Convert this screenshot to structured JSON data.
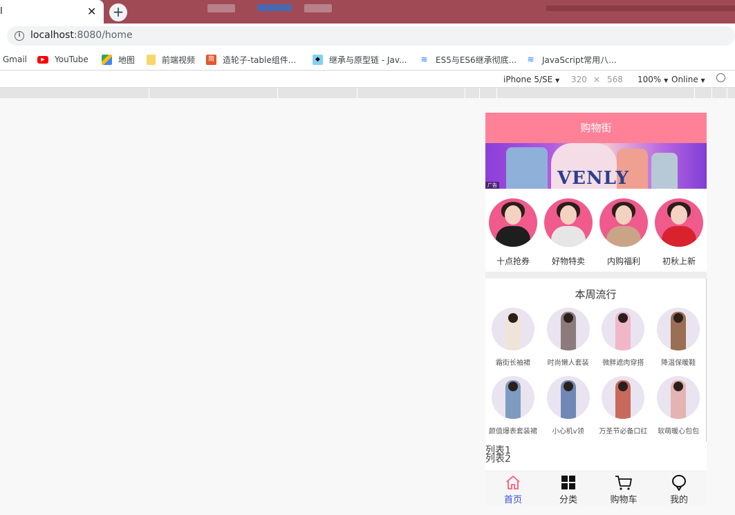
{
  "browser": {
    "tab_title": "I",
    "tab_close": "✕",
    "new_tab": "+",
    "url_host": "localhost",
    "url_rest": ":8080/home"
  },
  "bookmarks": [
    {
      "label": "Gmail",
      "icon": "gmail-icon"
    },
    {
      "label": "YouTube",
      "icon": "youtube-icon",
      "color": "#ff0000"
    },
    {
      "label": "地图",
      "icon": "maps-icon",
      "color": "#34a853"
    },
    {
      "label": "前端视频",
      "icon": "folder-icon",
      "color": "#f9d66b"
    },
    {
      "label": "造轮子-table组件...",
      "icon": "jian-icon",
      "color": "#e4572e"
    },
    {
      "label": "继承与原型链 - Jav...",
      "icon": "mdn-icon",
      "color": "#83d0f2"
    },
    {
      "label": "ES5与ES6继承彻底...",
      "icon": "juejin-icon",
      "color": "#1e80ff"
    },
    {
      "label": "JavaScript常用八...",
      "icon": "juejin-icon",
      "color": "#1e80ff"
    }
  ],
  "device_toolbar": {
    "device": "iPhone 5/SE",
    "width": "320",
    "times": "×",
    "height": "568",
    "zoom": "100%",
    "network": "Online",
    "caret": "▼"
  },
  "app": {
    "title": "购物街",
    "banner_brand": "VENLY",
    "banner_ad": "广告",
    "recommends": [
      {
        "label": "十点抢券",
        "color": "#1e1e1e"
      },
      {
        "label": "好物特卖",
        "color": "#e6e6e6"
      },
      {
        "label": "内购福利",
        "color": "#c9a487"
      },
      {
        "label": "初秋上新",
        "color": "#d8232f"
      }
    ],
    "feature_title": "本周流行",
    "features": [
      {
        "label": "霜街长袖裙",
        "color": "#efe4d8"
      },
      {
        "label": "时尚懒人套装",
        "color": "#8d7a7c"
      },
      {
        "label": "微胖遮肉穿搭",
        "color": "#f0b7c8"
      },
      {
        "label": "降温保暖鞋",
        "color": "#9b6f53"
      },
      {
        "label": "颜值爆表套装裙",
        "color": "#7f9bbf"
      },
      {
        "label": "小心机v领",
        "color": "#6f88b5"
      },
      {
        "label": "万圣节必备口红",
        "color": "#c76a5c"
      },
      {
        "label": "软萌暖心包包",
        "color": "#e3b4b1"
      }
    ],
    "list_items": [
      "列表1",
      "列表2"
    ],
    "tabs": [
      {
        "label": "首页",
        "icon": "home-icon",
        "active": true
      },
      {
        "label": "分类",
        "icon": "category-icon",
        "active": false
      },
      {
        "label": "购物车",
        "icon": "cart-icon",
        "active": false
      },
      {
        "label": "我的",
        "icon": "profile-icon",
        "active": false
      }
    ],
    "accent": "#ff8198"
  }
}
